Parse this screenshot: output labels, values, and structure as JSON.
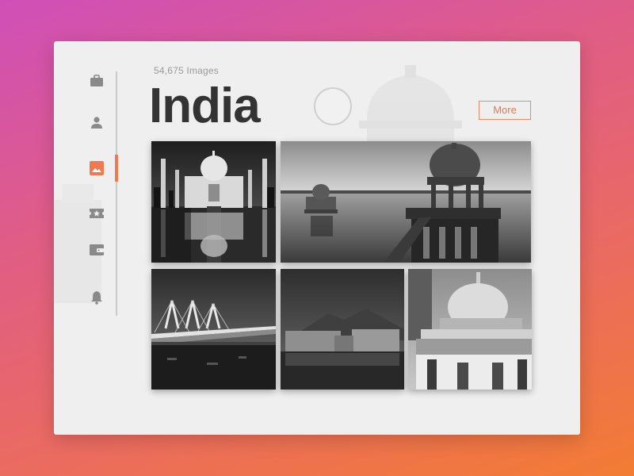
{
  "header": {
    "image_count": "54,675 Images",
    "title": "India",
    "more_label": "More"
  },
  "sidebar": {
    "items": [
      {
        "icon": "briefcase-icon",
        "active": false
      },
      {
        "icon": "user-icon",
        "active": false
      },
      {
        "icon": "image-icon",
        "active": true
      },
      {
        "icon": "ticket-star-icon",
        "active": false
      },
      {
        "icon": "wallet-icon",
        "active": false
      },
      {
        "icon": "bell-icon",
        "active": false
      }
    ]
  },
  "gallery": {
    "photos": [
      {
        "subject": "taj-mahal"
      },
      {
        "subject": "lake-pavilion"
      },
      {
        "subject": "sea-link-bridge"
      },
      {
        "subject": "palace-lake"
      },
      {
        "subject": "domed-tomb"
      }
    ]
  },
  "colors": {
    "accent": "#ef7a4f",
    "icon_gray": "#8a8a8a",
    "title": "#333333",
    "card": "#efefef"
  }
}
